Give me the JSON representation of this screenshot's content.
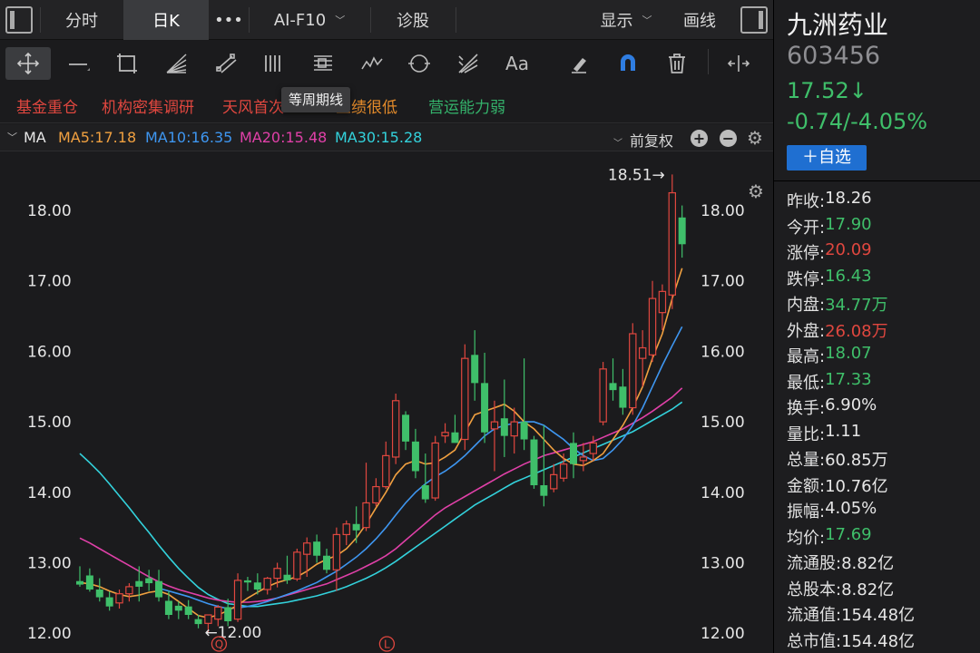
{
  "colors": {
    "up": "#e0473f",
    "down": "#3fbf6a",
    "ma5": "#f0a040",
    "ma10": "#3e96f0",
    "ma20": "#e040a8",
    "ma30": "#33d2dc"
  },
  "topbar": {
    "tabs": [
      {
        "label": "分时"
      },
      {
        "label": "日K"
      },
      {
        "label": "•••"
      },
      {
        "label": "AI-F10"
      },
      {
        "label": "诊股"
      }
    ],
    "display_label": "显示",
    "draw_label": "画线"
  },
  "toolbar": {
    "tools": [
      {
        "icon": "crosshair-move-icon"
      },
      {
        "icon": "line-segment-icon"
      },
      {
        "icon": "rectangle-icon"
      },
      {
        "icon": "fan-lines-icon"
      },
      {
        "icon": "channel-icon"
      },
      {
        "icon": "period-lines-icon"
      },
      {
        "icon": "fibonacci-icon"
      },
      {
        "icon": "wave-icon"
      },
      {
        "icon": "cycle-icon"
      },
      {
        "icon": "gann-icon"
      },
      {
        "icon": "text-icon"
      },
      {
        "icon": "eraser-icon"
      },
      {
        "icon": "magnet-icon"
      },
      {
        "icon": "trash-icon"
      },
      {
        "icon": "horizontal-expand-icon"
      }
    ],
    "text_tool_label": "Aa"
  },
  "tags": {
    "items": [
      {
        "label": "基金重仓",
        "color": "red"
      },
      {
        "label": "机构密集调研",
        "color": "red"
      },
      {
        "label": "天风首次",
        "color": "red"
      },
      {
        "label": "业绩很低",
        "color": "orange"
      },
      {
        "label": "营运能力弱",
        "color": "green"
      }
    ],
    "tooltip": "等周期线"
  },
  "ma_bar": {
    "label": "MA",
    "ma5": "MA5:17.18",
    "ma10": "MA10:16.35",
    "ma20": "MA20:15.48",
    "ma30": "MA30:15.28",
    "adjust": "前复权"
  },
  "chart_data": {
    "type": "candlestick",
    "y_ticks": [
      "18.00",
      "17.00",
      "16.00",
      "15.00",
      "14.00",
      "13.00",
      "12.00"
    ],
    "ylim": [
      12.0,
      18.51
    ],
    "high_marker": "18.51→",
    "low_marker": "←12.00",
    "event_markers": [
      "Q",
      "L"
    ],
    "candles": [
      {
        "o": 12.74,
        "h": 12.95,
        "l": 12.66,
        "c": 12.69
      },
      {
        "o": 12.82,
        "h": 12.92,
        "l": 12.59,
        "c": 12.62
      },
      {
        "o": 12.62,
        "h": 12.78,
        "l": 12.45,
        "c": 12.51
      },
      {
        "o": 12.51,
        "h": 12.59,
        "l": 12.32,
        "c": 12.38
      },
      {
        "o": 12.43,
        "h": 12.62,
        "l": 12.35,
        "c": 12.56
      },
      {
        "o": 12.56,
        "h": 12.71,
        "l": 12.45,
        "c": 12.66
      },
      {
        "o": 12.74,
        "h": 12.95,
        "l": 12.45,
        "c": 12.66
      },
      {
        "o": 12.78,
        "h": 12.9,
        "l": 12.6,
        "c": 12.71
      },
      {
        "o": 12.74,
        "h": 12.9,
        "l": 12.45,
        "c": 12.51
      },
      {
        "o": 12.46,
        "h": 12.6,
        "l": 12.2,
        "c": 12.26
      },
      {
        "o": 12.39,
        "h": 12.45,
        "l": 12.2,
        "c": 12.32
      },
      {
        "o": 12.38,
        "h": 12.47,
        "l": 12.2,
        "c": 12.26
      },
      {
        "o": 12.2,
        "h": 12.26,
        "l": 12.07,
        "c": 12.13
      },
      {
        "o": 12.14,
        "h": 12.26,
        "l": 12.0,
        "c": 12.26
      },
      {
        "o": 12.2,
        "h": 12.4,
        "l": 12.1,
        "c": 12.37
      },
      {
        "o": 12.37,
        "h": 12.49,
        "l": 12.1,
        "c": 12.17
      },
      {
        "o": 12.2,
        "h": 12.85,
        "l": 12.16,
        "c": 12.75
      },
      {
        "o": 12.75,
        "h": 12.8,
        "l": 12.6,
        "c": 12.72
      },
      {
        "o": 12.72,
        "h": 12.85,
        "l": 12.55,
        "c": 12.62
      },
      {
        "o": 12.62,
        "h": 12.8,
        "l": 12.55,
        "c": 12.78
      },
      {
        "o": 12.78,
        "h": 13.0,
        "l": 12.65,
        "c": 12.92
      },
      {
        "o": 12.83,
        "h": 13.1,
        "l": 12.7,
        "c": 12.75
      },
      {
        "o": 12.77,
        "h": 13.2,
        "l": 12.74,
        "c": 13.15
      },
      {
        "o": 13.12,
        "h": 13.36,
        "l": 12.8,
        "c": 13.28
      },
      {
        "o": 13.3,
        "h": 13.4,
        "l": 13.0,
        "c": 13.1
      },
      {
        "o": 13.1,
        "h": 13.2,
        "l": 12.85,
        "c": 12.9
      },
      {
        "o": 12.9,
        "h": 13.5,
        "l": 12.6,
        "c": 13.4
      },
      {
        "o": 13.4,
        "h": 13.6,
        "l": 13.25,
        "c": 13.55
      },
      {
        "o": 13.55,
        "h": 13.8,
        "l": 13.28,
        "c": 13.46
      },
      {
        "o": 13.5,
        "h": 14.42,
        "l": 13.45,
        "c": 13.85
      },
      {
        "o": 13.85,
        "h": 14.2,
        "l": 13.8,
        "c": 14.08
      },
      {
        "o": 14.08,
        "h": 14.72,
        "l": 14.05,
        "c": 14.52
      },
      {
        "o": 14.5,
        "h": 15.4,
        "l": 14.4,
        "c": 15.3
      },
      {
        "o": 15.1,
        "h": 15.15,
        "l": 14.6,
        "c": 14.72
      },
      {
        "o": 14.72,
        "h": 14.9,
        "l": 14.2,
        "c": 14.3
      },
      {
        "o": 14.1,
        "h": 14.55,
        "l": 13.85,
        "c": 13.9
      },
      {
        "o": 13.92,
        "h": 14.8,
        "l": 13.88,
        "c": 14.7
      },
      {
        "o": 14.8,
        "h": 14.98,
        "l": 14.7,
        "c": 14.85
      },
      {
        "o": 14.85,
        "h": 15.1,
        "l": 14.75,
        "c": 14.7
      },
      {
        "o": 14.75,
        "h": 16.1,
        "l": 14.6,
        "c": 15.9
      },
      {
        "o": 15.95,
        "h": 16.3,
        "l": 15.3,
        "c": 15.55
      },
      {
        "o": 15.55,
        "h": 15.98,
        "l": 14.7,
        "c": 14.85
      },
      {
        "o": 14.9,
        "h": 15.3,
        "l": 14.3,
        "c": 15.0
      },
      {
        "o": 15.05,
        "h": 15.6,
        "l": 14.5,
        "c": 14.8
      },
      {
        "o": 14.8,
        "h": 15.2,
        "l": 14.55,
        "c": 15.0
      },
      {
        "o": 15.0,
        "h": 15.9,
        "l": 14.6,
        "c": 14.75
      },
      {
        "o": 14.75,
        "h": 14.8,
        "l": 14.05,
        "c": 14.1
      },
      {
        "o": 14.1,
        "h": 14.95,
        "l": 13.8,
        "c": 13.95
      },
      {
        "o": 14.05,
        "h": 14.4,
        "l": 14.0,
        "c": 14.25
      },
      {
        "o": 14.2,
        "h": 14.55,
        "l": 14.15,
        "c": 14.4
      },
      {
        "o": 14.7,
        "h": 14.85,
        "l": 14.2,
        "c": 14.4
      },
      {
        "o": 14.45,
        "h": 14.7,
        "l": 14.3,
        "c": 14.5
      },
      {
        "o": 14.55,
        "h": 14.8,
        "l": 14.45,
        "c": 14.7
      },
      {
        "o": 15.0,
        "h": 15.85,
        "l": 14.95,
        "c": 15.75
      },
      {
        "o": 15.55,
        "h": 15.9,
        "l": 15.3,
        "c": 15.45
      },
      {
        "o": 15.5,
        "h": 15.75,
        "l": 15.1,
        "c": 15.2
      },
      {
        "o": 15.2,
        "h": 16.4,
        "l": 15.1,
        "c": 16.25
      },
      {
        "o": 15.9,
        "h": 16.3,
        "l": 15.5,
        "c": 16.05
      },
      {
        "o": 15.95,
        "h": 17.0,
        "l": 15.85,
        "c": 16.75
      },
      {
        "o": 16.55,
        "h": 16.95,
        "l": 16.3,
        "c": 16.85
      },
      {
        "o": 16.8,
        "h": 18.51,
        "l": 16.6,
        "c": 18.25
      },
      {
        "o": 17.9,
        "h": 18.07,
        "l": 17.33,
        "c": 17.52
      }
    ],
    "ma5": [
      12.72,
      12.7,
      12.66,
      12.6,
      12.55,
      12.52,
      12.54,
      12.58,
      12.6,
      12.55,
      12.45,
      12.35,
      12.25,
      12.22,
      12.26,
      12.32,
      12.4,
      12.5,
      12.58,
      12.66,
      12.72,
      12.76,
      12.8,
      12.88,
      12.98,
      13.05,
      13.1,
      13.2,
      13.35,
      13.55,
      13.78,
      14.0,
      14.25,
      14.4,
      14.45,
      14.4,
      14.42,
      14.5,
      14.6,
      14.85,
      15.1,
      15.15,
      15.2,
      15.25,
      15.15,
      15.0,
      14.9,
      14.75,
      14.6,
      14.48,
      14.4,
      14.38,
      14.45,
      14.55,
      14.75,
      14.95,
      15.2,
      15.5,
      15.9,
      16.25,
      16.75,
      17.18
    ],
    "ma10": [
      null,
      null,
      null,
      null,
      null,
      null,
      null,
      null,
      12.64,
      12.6,
      12.56,
      12.52,
      12.47,
      12.42,
      12.38,
      12.35,
      12.36,
      12.38,
      12.41,
      12.45,
      12.5,
      12.55,
      12.6,
      12.66,
      12.72,
      12.8,
      12.88,
      12.98,
      13.08,
      13.2,
      13.34,
      13.5,
      13.68,
      13.85,
      14.0,
      14.12,
      14.22,
      14.3,
      14.4,
      14.52,
      14.66,
      14.8,
      14.9,
      14.95,
      14.98,
      15.0,
      15.0,
      14.95,
      14.85,
      14.75,
      14.62,
      14.52,
      14.45,
      14.48,
      14.6,
      14.75,
      14.95,
      15.2,
      15.5,
      15.8,
      16.08,
      16.35
    ],
    "ma20": [
      13.35,
      13.28,
      13.2,
      13.12,
      13.04,
      12.96,
      12.88,
      12.8,
      12.73,
      12.67,
      12.62,
      12.58,
      12.54,
      12.5,
      12.47,
      12.45,
      12.44,
      12.44,
      12.45,
      12.47,
      12.5,
      12.54,
      12.58,
      12.62,
      12.66,
      12.7,
      12.76,
      12.82,
      12.88,
      12.95,
      13.02,
      13.1,
      13.2,
      13.32,
      13.44,
      13.56,
      13.68,
      13.78,
      13.86,
      13.94,
      14.02,
      14.1,
      14.18,
      14.26,
      14.33,
      14.4,
      14.46,
      14.52,
      14.56,
      14.6,
      14.64,
      14.68,
      14.72,
      14.78,
      14.84,
      14.9,
      14.98,
      15.06,
      15.15,
      15.25,
      15.35,
      15.48
    ],
    "ma30": [
      14.55,
      14.42,
      14.28,
      14.12,
      13.95,
      13.78,
      13.6,
      13.43,
      13.25,
      13.08,
      12.92,
      12.78,
      12.65,
      12.55,
      12.48,
      12.42,
      12.4,
      12.38,
      12.38,
      12.4,
      12.42,
      12.44,
      12.47,
      12.5,
      12.53,
      12.57,
      12.61,
      12.66,
      12.72,
      12.78,
      12.85,
      12.93,
      13.02,
      13.12,
      13.22,
      13.32,
      13.42,
      13.52,
      13.62,
      13.72,
      13.82,
      13.9,
      13.98,
      14.06,
      14.14,
      14.2,
      14.26,
      14.32,
      14.38,
      14.44,
      14.5,
      14.56,
      14.62,
      14.68,
      14.74,
      14.8,
      14.86,
      14.94,
      15.02,
      15.1,
      15.18,
      15.28
    ]
  },
  "stock": {
    "name": "九洲药业",
    "code": "603456",
    "price": "17.52↓",
    "change": "-0.74/-4.05%",
    "fav_button": "＋自选"
  },
  "stats": [
    {
      "label": "昨收:",
      "value": "18.26",
      "color": "white"
    },
    {
      "label": "今开:",
      "value": "17.90",
      "color": "green"
    },
    {
      "label": "涨停:",
      "value": "20.09",
      "color": "red"
    },
    {
      "label": "跌停:",
      "value": "16.43",
      "color": "green"
    },
    {
      "label": "内盘:",
      "value": "34.77万",
      "color": "green"
    },
    {
      "label": "外盘:",
      "value": "26.08万",
      "color": "red"
    },
    {
      "label": "最高:",
      "value": "18.07",
      "color": "green"
    },
    {
      "label": "最低:",
      "value": "17.33",
      "color": "green"
    },
    {
      "label": "换手:",
      "value": "6.90%",
      "color": "white"
    },
    {
      "label": "量比:",
      "value": "1.11",
      "color": "white"
    },
    {
      "label": "总量:",
      "value": "60.85万",
      "color": "white"
    },
    {
      "label": "金额:",
      "value": "10.76亿",
      "color": "white"
    },
    {
      "label": "振幅:",
      "value": "4.05%",
      "color": "white"
    },
    {
      "label": "均价:",
      "value": "17.69",
      "color": "green"
    },
    {
      "label": "流通股:",
      "value": "8.82亿",
      "color": "white"
    },
    {
      "label": "总股本:",
      "value": "8.82亿",
      "color": "white"
    },
    {
      "label": "流通值:",
      "value": "154.48亿",
      "color": "white"
    },
    {
      "label": "总市值:",
      "value": "154.48亿",
      "color": "white"
    }
  ]
}
